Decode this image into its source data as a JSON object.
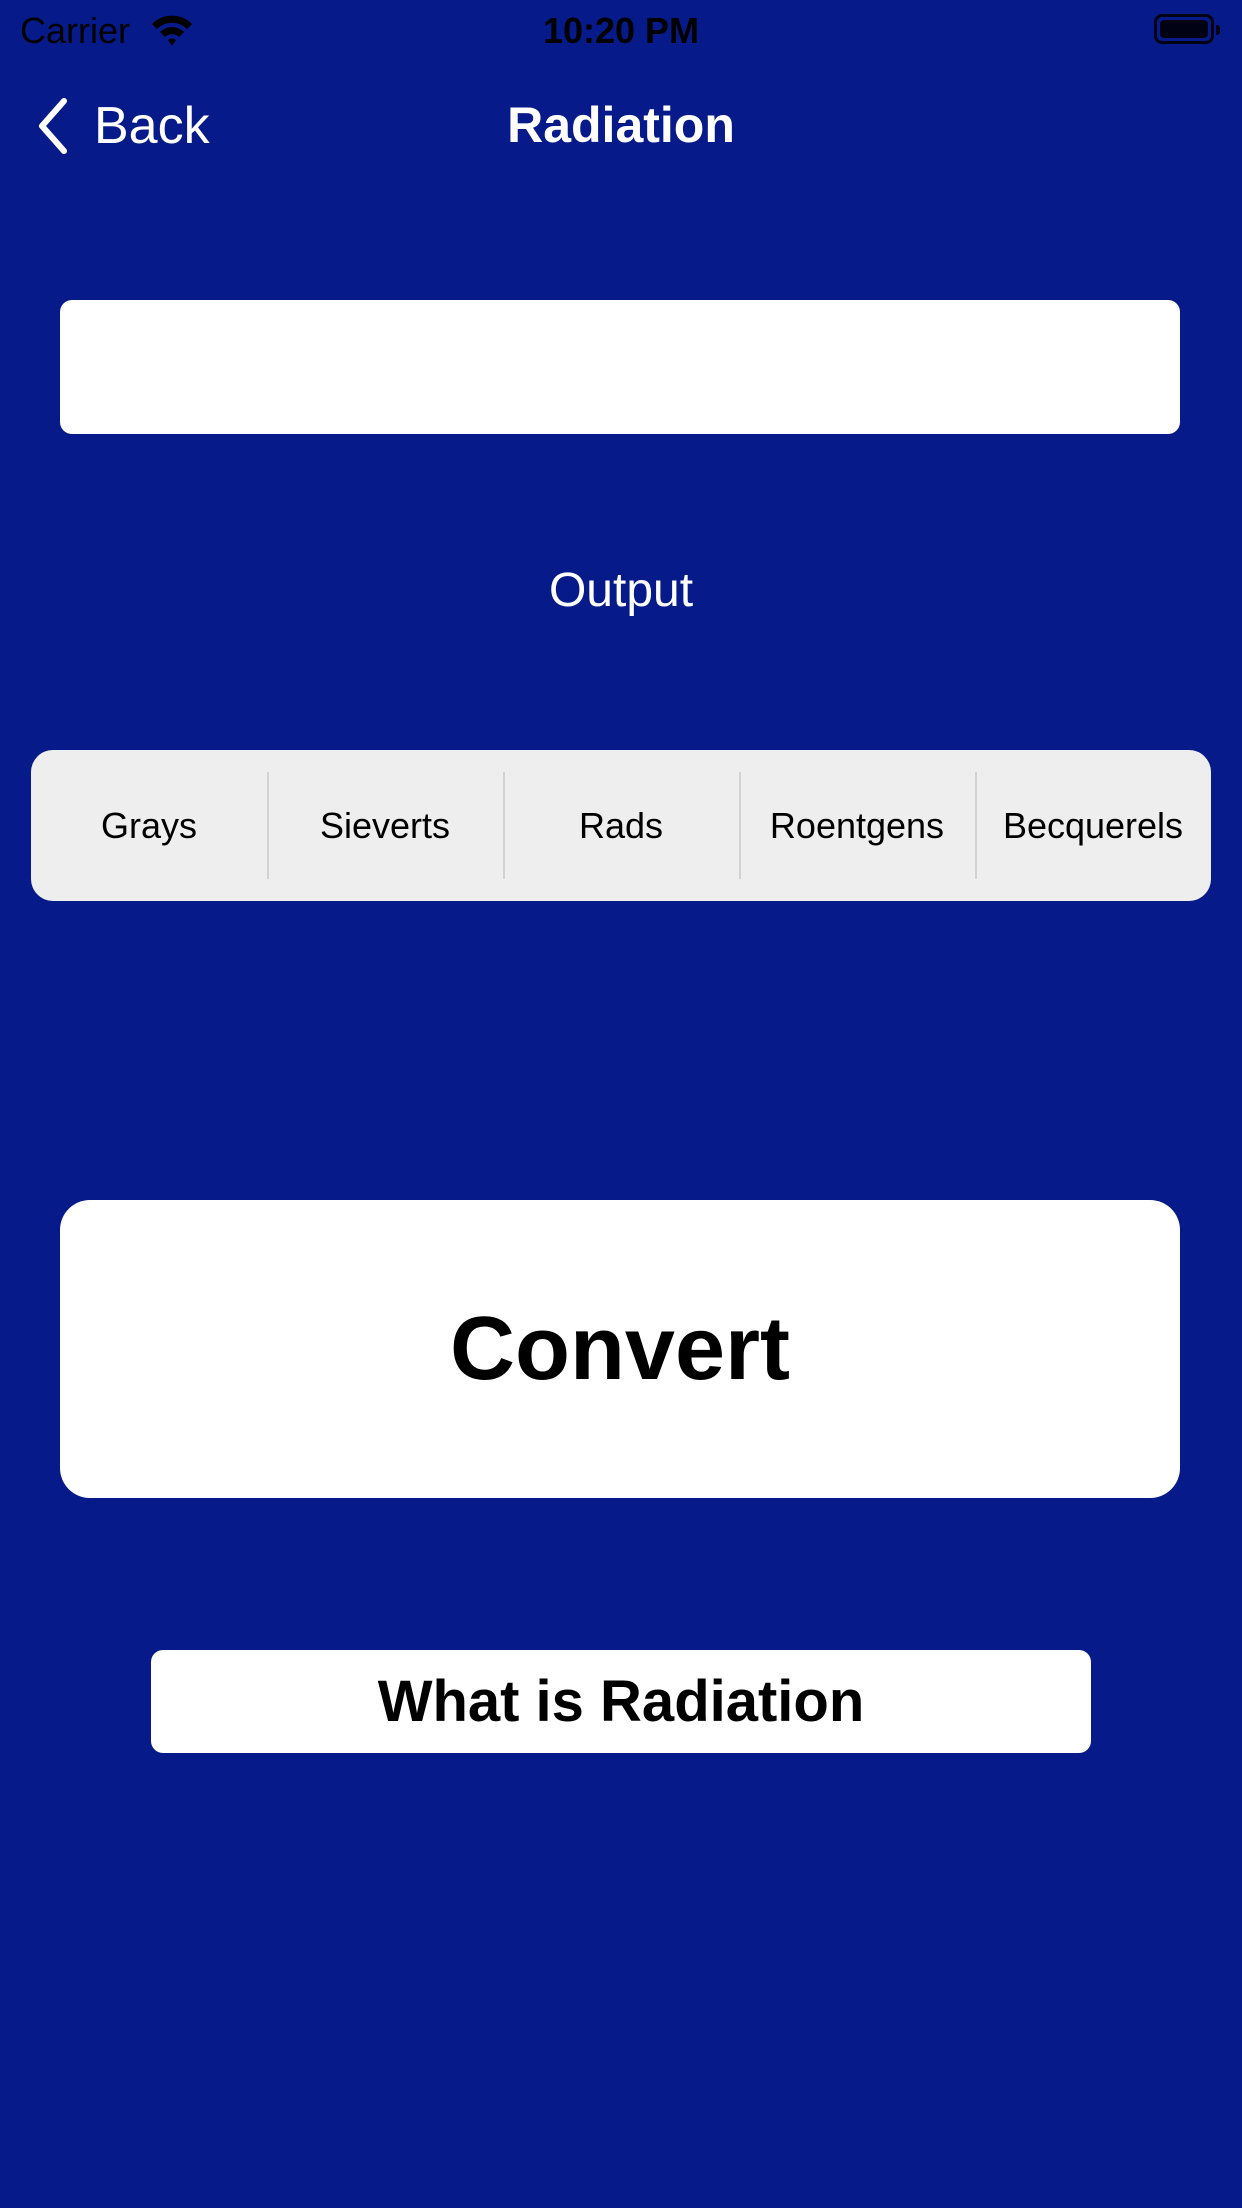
{
  "status_bar": {
    "carrier": "Carrier",
    "time": "10:20 PM",
    "wifi_icon": "wifi-icon",
    "battery_icon": "battery-icon"
  },
  "nav": {
    "back_label": "Back",
    "title": "Radiation",
    "back_icon": "chevron-left-icon"
  },
  "input": {
    "value": "",
    "placeholder": ""
  },
  "output_label": "Output",
  "units": [
    "Grays",
    "Sieverts",
    "Rads",
    "Roentgens",
    "Becquerels"
  ],
  "convert_label": "Convert",
  "info_label": "What is Radiation",
  "colors": {
    "background": "#071A8A",
    "segment_bg": "#EEEEEE"
  }
}
